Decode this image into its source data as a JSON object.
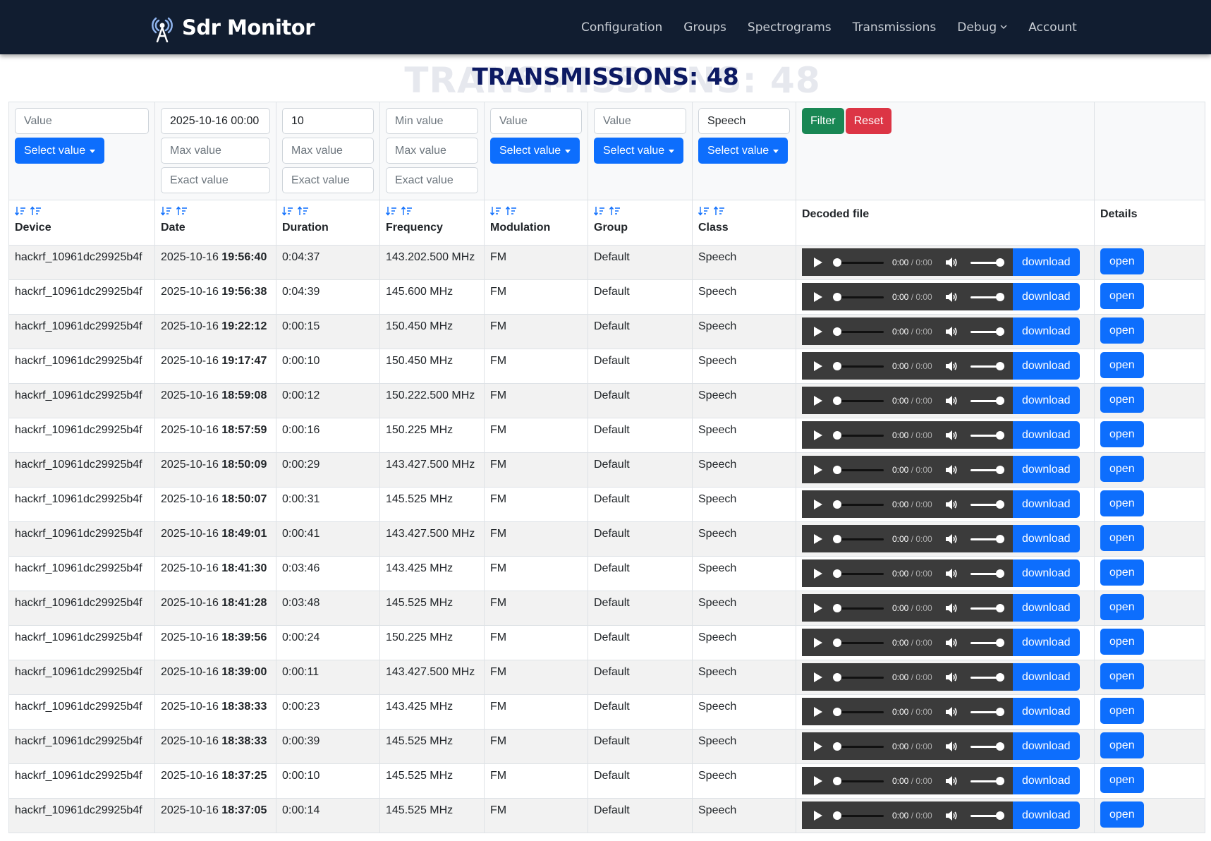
{
  "app": {
    "brand": "Sdr Monitor"
  },
  "nav": [
    {
      "label": "Configuration",
      "dropdown": false
    },
    {
      "label": "Groups",
      "dropdown": false
    },
    {
      "label": "Spectrograms",
      "dropdown": false
    },
    {
      "label": "Transmissions",
      "dropdown": false
    },
    {
      "label": "Debug",
      "dropdown": true
    },
    {
      "label": "Account",
      "dropdown": false
    }
  ],
  "page": {
    "title": "TRANSMISSIONS: 48",
    "ghost_title": "TRANSMISSIONS: 48"
  },
  "filters": {
    "device": {
      "value_placeholder": "Value",
      "select_label": "Select value"
    },
    "date": {
      "min_value": "2025-10-16 00:00",
      "max_placeholder": "Max value",
      "exact_placeholder": "Exact value"
    },
    "duration": {
      "min_value": "10",
      "max_placeholder": "Max value",
      "exact_placeholder": "Exact value"
    },
    "frequency": {
      "min_placeholder": "Min value",
      "max_placeholder": "Max value",
      "exact_placeholder": "Exact value"
    },
    "modulation": {
      "value_placeholder": "Value",
      "select_label": "Select value"
    },
    "group": {
      "value_placeholder": "Value",
      "select_label": "Select value"
    },
    "class": {
      "value": "Speech",
      "select_label": "Select value"
    },
    "filter_label": "Filter",
    "reset_label": "Reset"
  },
  "columns": {
    "device": "Device",
    "date": "Date",
    "duration": "Duration",
    "frequency": "Frequency",
    "modulation": "Modulation",
    "group": "Group",
    "class": "Class",
    "decoded": "Decoded file",
    "details": "Details"
  },
  "player": {
    "current": "0:00",
    "separator": " / ",
    "total": "0:00",
    "download_label": "download",
    "open_label": "open"
  },
  "icons": {
    "sort_desc": "sort-desc-icon",
    "sort_asc": "sort-asc-icon",
    "play": "play-icon",
    "volume": "volume-icon",
    "brand": "antenna-icon"
  },
  "colors": {
    "navbar": "#111d30",
    "title": "#0d1a63",
    "primary": "#0d6efd",
    "success": "#198754",
    "danger": "#dc3545",
    "player": "#3b3b3b"
  },
  "rows": [
    {
      "device": "hackrf_10961dc29925b4f",
      "date": "2025-10-16",
      "time": "19:56:40",
      "duration": "0:04:37",
      "frequency": "143.202.500 MHz",
      "modulation": "FM",
      "group": "Default",
      "class": "Speech"
    },
    {
      "device": "hackrf_10961dc29925b4f",
      "date": "2025-10-16",
      "time": "19:56:38",
      "duration": "0:04:39",
      "frequency": "145.600 MHz",
      "modulation": "FM",
      "group": "Default",
      "class": "Speech"
    },
    {
      "device": "hackrf_10961dc29925b4f",
      "date": "2025-10-16",
      "time": "19:22:12",
      "duration": "0:00:15",
      "frequency": "150.450 MHz",
      "modulation": "FM",
      "group": "Default",
      "class": "Speech"
    },
    {
      "device": "hackrf_10961dc29925b4f",
      "date": "2025-10-16",
      "time": "19:17:47",
      "duration": "0:00:10",
      "frequency": "150.450 MHz",
      "modulation": "FM",
      "group": "Default",
      "class": "Speech"
    },
    {
      "device": "hackrf_10961dc29925b4f",
      "date": "2025-10-16",
      "time": "18:59:08",
      "duration": "0:00:12",
      "frequency": "150.222.500 MHz",
      "modulation": "FM",
      "group": "Default",
      "class": "Speech"
    },
    {
      "device": "hackrf_10961dc29925b4f",
      "date": "2025-10-16",
      "time": "18:57:59",
      "duration": "0:00:16",
      "frequency": "150.225 MHz",
      "modulation": "FM",
      "group": "Default",
      "class": "Speech"
    },
    {
      "device": "hackrf_10961dc29925b4f",
      "date": "2025-10-16",
      "time": "18:50:09",
      "duration": "0:00:29",
      "frequency": "143.427.500 MHz",
      "modulation": "FM",
      "group": "Default",
      "class": "Speech"
    },
    {
      "device": "hackrf_10961dc29925b4f",
      "date": "2025-10-16",
      "time": "18:50:07",
      "duration": "0:00:31",
      "frequency": "145.525 MHz",
      "modulation": "FM",
      "group": "Default",
      "class": "Speech"
    },
    {
      "device": "hackrf_10961dc29925b4f",
      "date": "2025-10-16",
      "time": "18:49:01",
      "duration": "0:00:41",
      "frequency": "143.427.500 MHz",
      "modulation": "FM",
      "group": "Default",
      "class": "Speech"
    },
    {
      "device": "hackrf_10961dc29925b4f",
      "date": "2025-10-16",
      "time": "18:41:30",
      "duration": "0:03:46",
      "frequency": "143.425 MHz",
      "modulation": "FM",
      "group": "Default",
      "class": "Speech"
    },
    {
      "device": "hackrf_10961dc29925b4f",
      "date": "2025-10-16",
      "time": "18:41:28",
      "duration": "0:03:48",
      "frequency": "145.525 MHz",
      "modulation": "FM",
      "group": "Default",
      "class": "Speech"
    },
    {
      "device": "hackrf_10961dc29925b4f",
      "date": "2025-10-16",
      "time": "18:39:56",
      "duration": "0:00:24",
      "frequency": "150.225 MHz",
      "modulation": "FM",
      "group": "Default",
      "class": "Speech"
    },
    {
      "device": "hackrf_10961dc29925b4f",
      "date": "2025-10-16",
      "time": "18:39:00",
      "duration": "0:00:11",
      "frequency": "143.427.500 MHz",
      "modulation": "FM",
      "group": "Default",
      "class": "Speech"
    },
    {
      "device": "hackrf_10961dc29925b4f",
      "date": "2025-10-16",
      "time": "18:38:33",
      "duration": "0:00:23",
      "frequency": "143.425 MHz",
      "modulation": "FM",
      "group": "Default",
      "class": "Speech"
    },
    {
      "device": "hackrf_10961dc29925b4f",
      "date": "2025-10-16",
      "time": "18:38:33",
      "duration": "0:00:39",
      "frequency": "145.525 MHz",
      "modulation": "FM",
      "group": "Default",
      "class": "Speech"
    },
    {
      "device": "hackrf_10961dc29925b4f",
      "date": "2025-10-16",
      "time": "18:37:25",
      "duration": "0:00:10",
      "frequency": "145.525 MHz",
      "modulation": "FM",
      "group": "Default",
      "class": "Speech"
    },
    {
      "device": "hackrf_10961dc29925b4f",
      "date": "2025-10-16",
      "time": "18:37:05",
      "duration": "0:00:14",
      "frequency": "145.525 MHz",
      "modulation": "FM",
      "group": "Default",
      "class": "Speech"
    }
  ]
}
